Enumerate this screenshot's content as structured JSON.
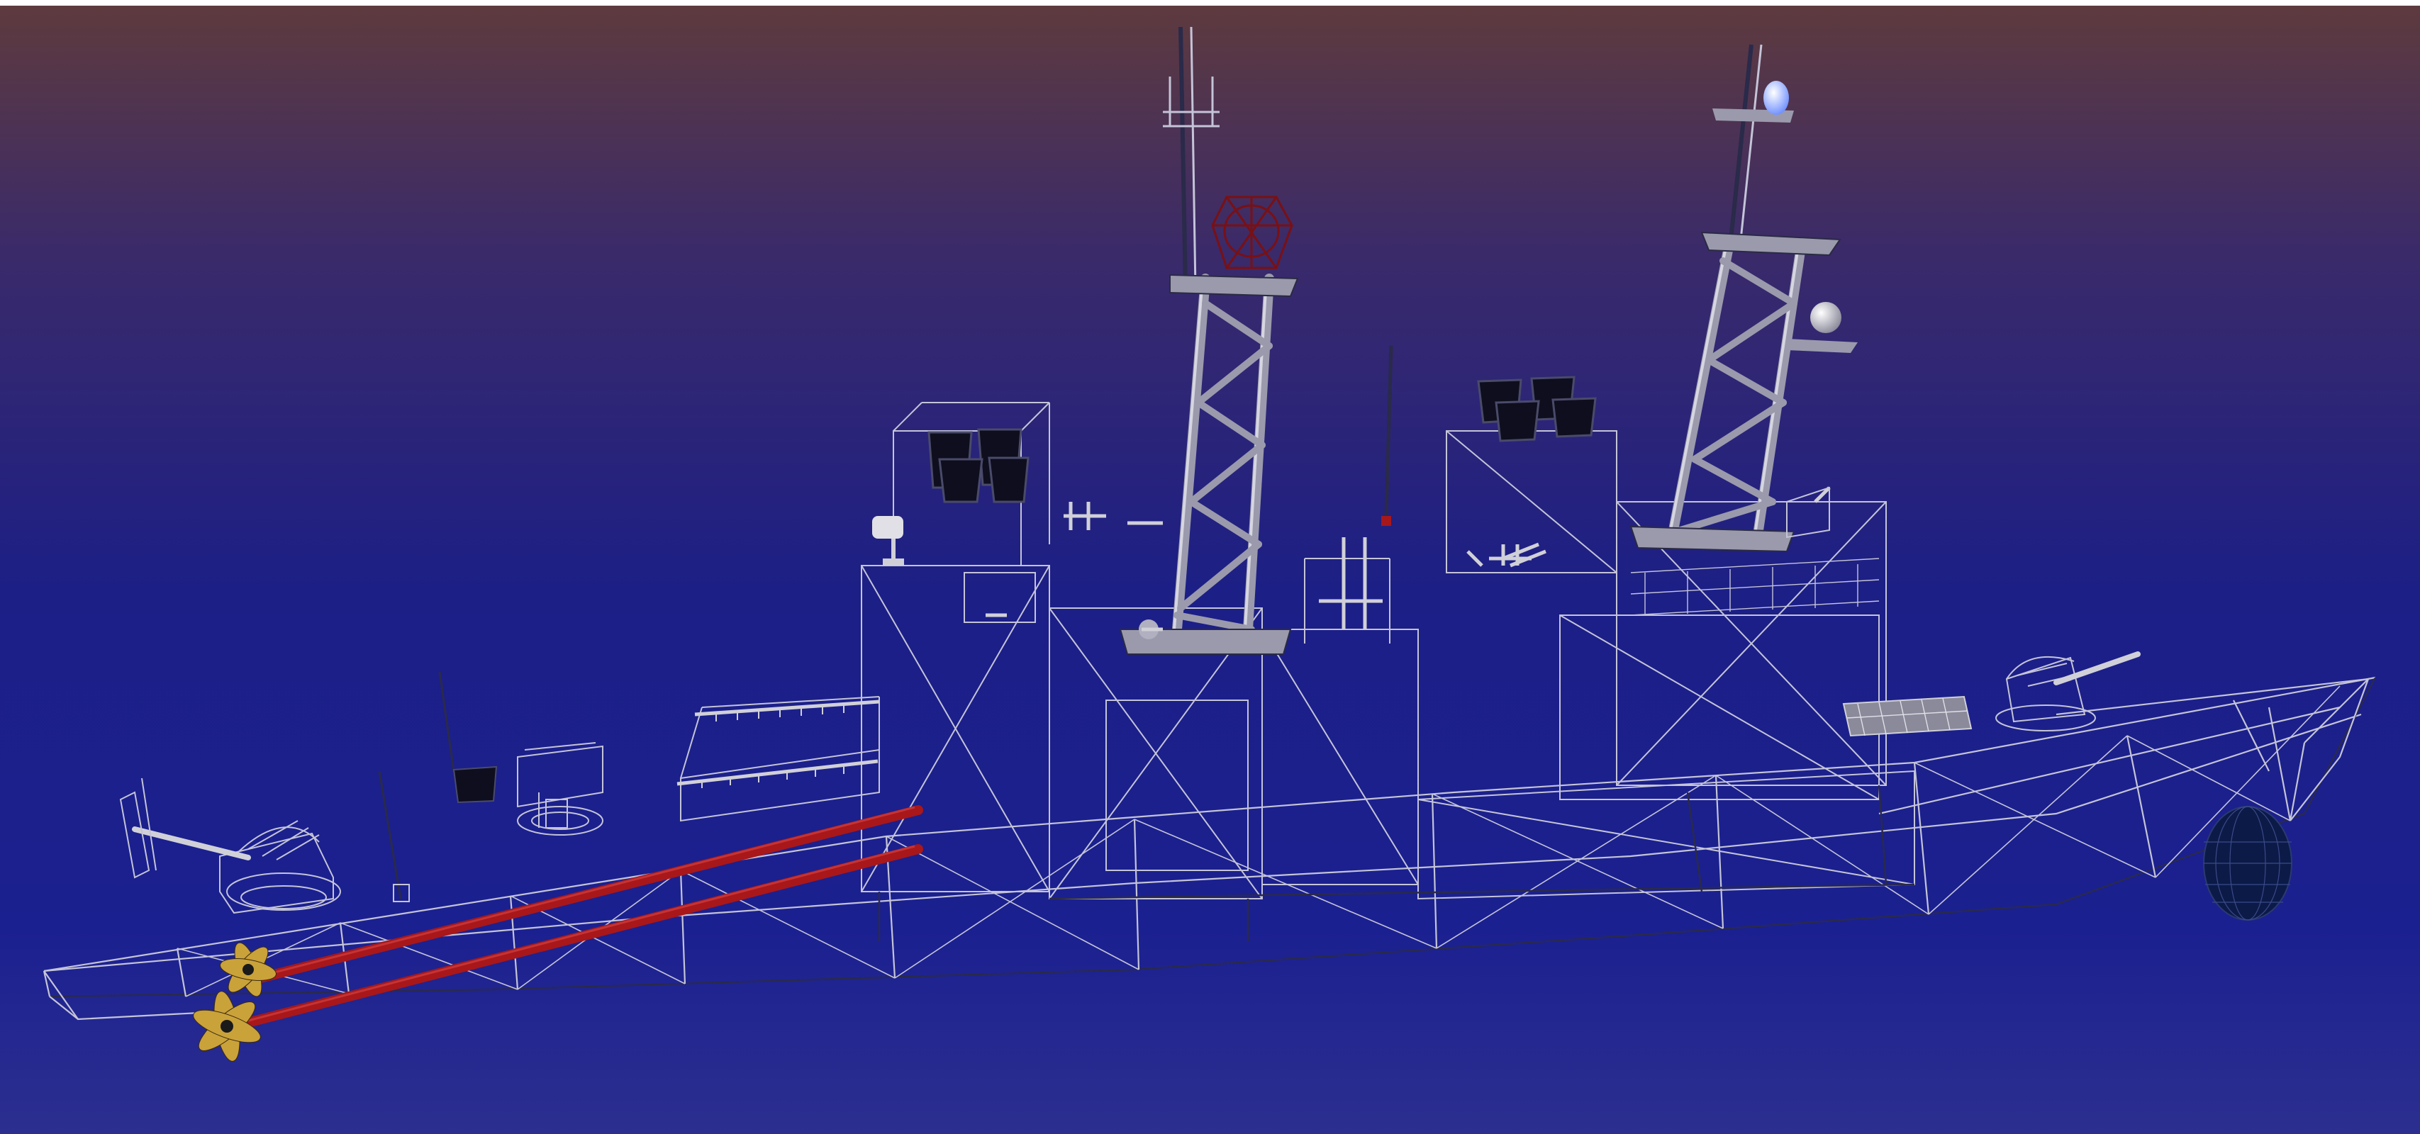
{
  "viewport": {
    "background_gradient": [
      "#5e3a3e",
      "#3a2a6a",
      "#1c1f86",
      "#1b2090",
      "#2c2f8f"
    ],
    "top_strip_color": "#ffffff"
  },
  "model": {
    "render_mode": "wireframe",
    "subject": "warship",
    "colors": {
      "hull_lines": "#c4c4d8",
      "hull_shadow_lines": "#2a2a4a",
      "mast_lattice": "#9a9aac",
      "mast_highlight": "#d6d6e2",
      "propeller_shafts": "#a8171a",
      "propellers": "#caa23a",
      "radar_dish": "#7a1014",
      "sonar_dome": "#0c1a48",
      "masthead_light": "#6a8cff",
      "radome": "#e8e8ee",
      "launcher_canisters": "#0e0e1e",
      "deck_equipment": "#d0d0d8"
    },
    "icons": [
      "mast-icon",
      "radar-icon",
      "gun-turret-icon",
      "propeller-icon",
      "sonar-dome-icon",
      "light-icon"
    ]
  }
}
